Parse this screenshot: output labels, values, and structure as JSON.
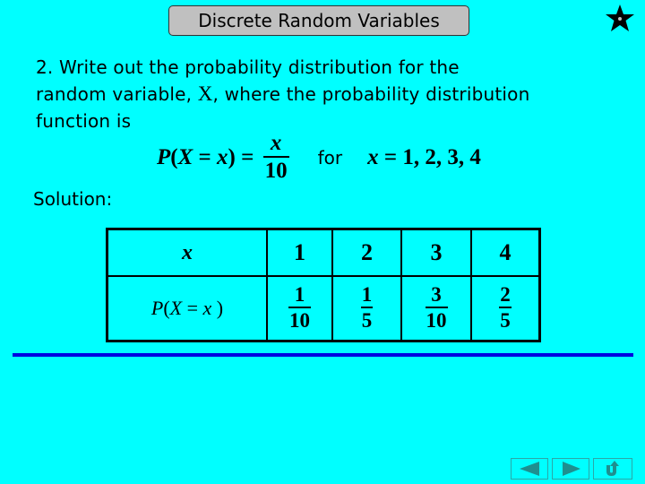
{
  "slide": {
    "title": "Discrete Random Variables",
    "colors": {
      "background": "#00ffff",
      "title_box": "#c0c0c0",
      "rule": "#0000e0",
      "nav_icon": "#1f8f8f"
    }
  },
  "problem": {
    "line1": "2. Write out the probability distribution for the",
    "line2_before": "random variable, ",
    "variable": "X",
    "line2_after": ", where the probability distribution",
    "line3": "function is"
  },
  "formula": {
    "lhs_P": "P",
    "lhs_open": "(",
    "lhs_X": "X",
    "lhs_eq": " = ",
    "lhs_x": "x",
    "lhs_close": ")",
    "equals": " = ",
    "numerator": "x",
    "denominator": "10",
    "for_word": "for",
    "domain_var": "x",
    "domain_eq": " = ",
    "domain_values": "1, 2, 3, 4"
  },
  "solution_label": "Solution:",
  "distribution_table": {
    "row_header_x": "x",
    "row_header_p": {
      "P": "P",
      "open": "(",
      "X": "X",
      "eq": " = ",
      "x": "x",
      "close": " )"
    },
    "columns": [
      {
        "x": "1",
        "p_num": "1",
        "p_den": "10"
      },
      {
        "x": "2",
        "p_num": "1",
        "p_den": "5"
      },
      {
        "x": "3",
        "p_num": "3",
        "p_den": "10"
      },
      {
        "x": "4",
        "p_num": "2",
        "p_den": "5"
      }
    ]
  },
  "navigation": {
    "buttons": [
      {
        "icon": "arrow-left-icon"
      },
      {
        "icon": "arrow-right-icon"
      },
      {
        "icon": "return-icon"
      }
    ]
  }
}
